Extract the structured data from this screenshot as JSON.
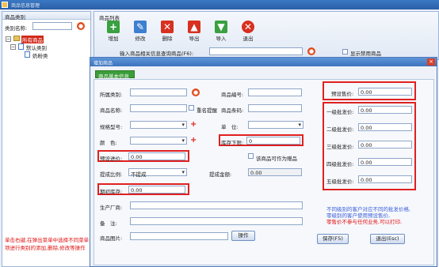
{
  "window": {
    "title": "商品信息管理"
  },
  "left": {
    "header": "商品类别",
    "category_label": "类别名称:",
    "tree": {
      "root": "所有商品",
      "child": "默认类别",
      "leaf": "奶粉类"
    },
    "note": "单击右键,在弹出菜单中选择不同菜单项进行类别的添加,删除,修改等操作"
  },
  "right": {
    "header": "商品列表",
    "toolbar": [
      {
        "label": "增加",
        "icon": "add-icon",
        "color": "#3aa040"
      },
      {
        "label": "修改",
        "icon": "edit-icon",
        "color": "#3e7fd0"
      },
      {
        "label": "删除",
        "icon": "delete-icon",
        "color": "#d83020"
      },
      {
        "label": "导出",
        "icon": "export-icon",
        "color": "#d83020"
      },
      {
        "label": "导入",
        "icon": "import-icon",
        "color": "#3aa040"
      },
      {
        "label": "退出",
        "icon": "exit-icon",
        "color": "#d83020"
      }
    ],
    "query_label": "输入商品相关信息查询商品(F6):",
    "show_disabled": "显示禁用商品"
  },
  "dialog": {
    "title": "增加商品",
    "tab": "商品基本信息",
    "fields": {
      "category": "所属类别:",
      "product_no": "商品编号:",
      "name": "商品名称:",
      "name_dup": "重名提醒",
      "barcode": "商品条码:",
      "spec": "规格型号:",
      "unit": "单　位:",
      "color": "颜　色:",
      "stock_limit": "库存下限:",
      "stock_limit_value": "0",
      "purchase_price": "预设进价:",
      "purchase_price_value": "0.00",
      "gift_label": "该商品可作为赠品",
      "commission": "提成比例:",
      "commission_value": "不提成",
      "commission_amount": "提成金额:",
      "commission_amount_value": "0.00",
      "initial_stock": "期初库存:",
      "initial_stock_value": "0.00",
      "manufacturer": "生产厂商:",
      "remark": "备　注:",
      "image": "商品图片:",
      "operate_btn": "操作"
    },
    "prices": {
      "sale_label": "预设售价:",
      "sale_value": "0.00",
      "levels": [
        {
          "label": "一级批发价:",
          "value": "0.00"
        },
        {
          "label": "二级批发价:",
          "value": "0.00"
        },
        {
          "label": "三级批发价:",
          "value": "0.00"
        },
        {
          "label": "四级批发价:",
          "value": "0.00"
        },
        {
          "label": "五级批发价:",
          "value": "0.00"
        }
      ]
    },
    "note": [
      "不同级别的客户对应不同的批发价格,",
      "零级别的客户使用预设售价,",
      "零售价不参与任何业务,可以打印."
    ],
    "save_btn": "保存(F5)",
    "exit_btn": "退出(Esc)"
  }
}
